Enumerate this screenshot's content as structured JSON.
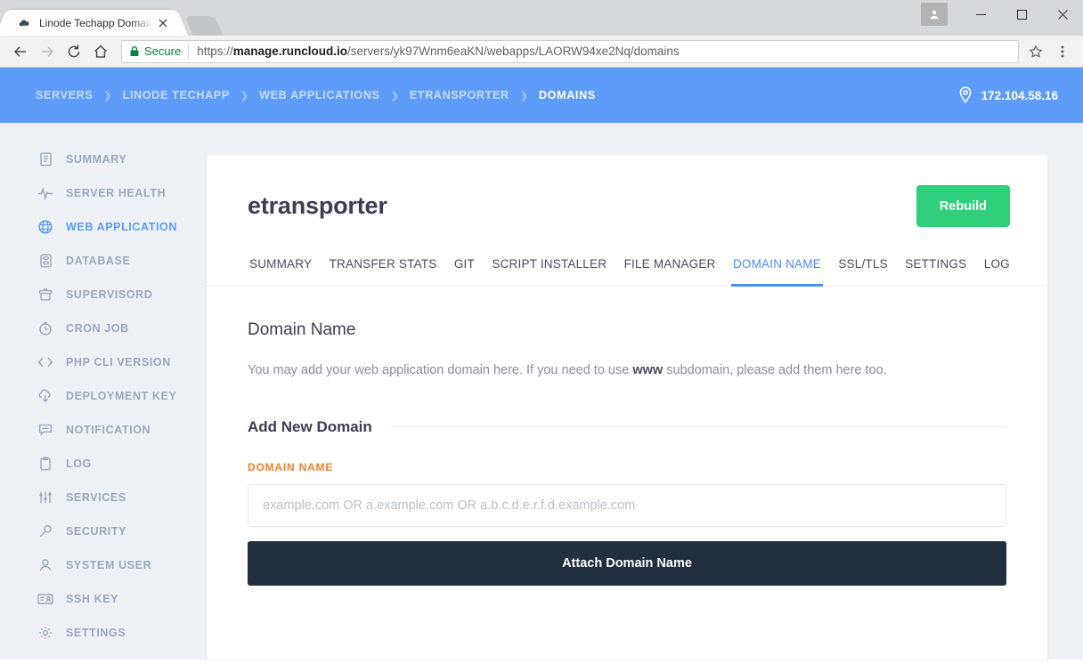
{
  "browser": {
    "tab": {
      "title": "Linode Techapp Domain",
      "favicon": "cloud-icon",
      "close": "×"
    },
    "new_tab_label": "+",
    "window": {
      "minimize": "—",
      "maximize": "□",
      "close": "✕",
      "avatar": "profile-avatar"
    },
    "nav": {
      "back": "←",
      "forward": "→",
      "reload": "↻",
      "home": "⌂"
    },
    "omnibox": {
      "security_label": "Secure",
      "url_scheme": "https://",
      "url_host": "manage.runcloud.io",
      "url_path": "/servers/yk97Wnm6eaKN/webapps/LAORW94xe2Nq/domains"
    }
  },
  "topbar": {
    "breadcrumb": [
      {
        "label": "SERVERS",
        "active": false
      },
      {
        "label": "LINODE TECHAPP",
        "active": false
      },
      {
        "label": "WEB APPLICATIONS",
        "active": false
      },
      {
        "label": "ETRANSPORTER",
        "active": false
      },
      {
        "label": "DOMAINS",
        "active": true
      }
    ],
    "separator": "❯",
    "server_ip": "172.104.58.16",
    "accent_color": "#5d9cf8"
  },
  "sidebar": {
    "items": [
      {
        "label": "SUMMARY",
        "icon": "document-icon",
        "active": false
      },
      {
        "label": "SERVER HEALTH",
        "icon": "pulse-icon",
        "active": false
      },
      {
        "label": "WEB APPLICATION",
        "icon": "globe-icon",
        "active": true
      },
      {
        "label": "DATABASE",
        "icon": "database-icon",
        "active": false
      },
      {
        "label": "SUPERVISORD",
        "icon": "basket-icon",
        "active": false
      },
      {
        "label": "CRON JOB",
        "icon": "clock-icon",
        "active": false
      },
      {
        "label": "PHP CLI VERSION",
        "icon": "code-icon",
        "active": false
      },
      {
        "label": "DEPLOYMENT KEY",
        "icon": "cloud-download-icon",
        "active": false
      },
      {
        "label": "NOTIFICATION",
        "icon": "speech-bubble-icon",
        "active": false
      },
      {
        "label": "LOG",
        "icon": "clipboard-icon",
        "active": false
      },
      {
        "label": "SERVICES",
        "icon": "sliders-icon",
        "active": false
      },
      {
        "label": "SECURITY",
        "icon": "key-icon",
        "active": false
      },
      {
        "label": "SYSTEM USER",
        "icon": "user-icon",
        "active": false
      },
      {
        "label": "SSH KEY",
        "icon": "id-card-icon",
        "active": false
      },
      {
        "label": "SETTINGS",
        "icon": "gear-icon",
        "active": false
      }
    ],
    "active_color": "#5b9bf8",
    "inactive_color": "#9aa8bd"
  },
  "card": {
    "app_title": "etransporter",
    "rebuild_label": "Rebuild",
    "rebuild_color": "#30cf7c",
    "tabs": [
      {
        "label": "SUMMARY",
        "active": false
      },
      {
        "label": "TRANSFER STATS",
        "active": false
      },
      {
        "label": "GIT",
        "active": false
      },
      {
        "label": "SCRIPT INSTALLER",
        "active": false
      },
      {
        "label": "FILE MANAGER",
        "active": false
      },
      {
        "label": "DOMAIN NAME",
        "active": true
      },
      {
        "label": "SSL/TLS",
        "active": false
      },
      {
        "label": "SETTINGS",
        "active": false
      },
      {
        "label": "LOG",
        "active": false
      }
    ],
    "active_tab_color": "#4a8ff5"
  },
  "panel": {
    "title": "Domain Name",
    "description_before": "You may add your web application domain here. If you need to use ",
    "description_bold": "www",
    "description_after": " subdomain, please add them here too.",
    "section_title": "Add New Domain",
    "field_label": "DOMAIN NAME",
    "field_label_color": "#f5802b",
    "input_value": "",
    "input_placeholder": "example.com OR a.example.com OR a.b.c.d.e.r.f.d.example.com",
    "submit_label": "Attach Domain Name",
    "submit_color": "#222f3e"
  }
}
